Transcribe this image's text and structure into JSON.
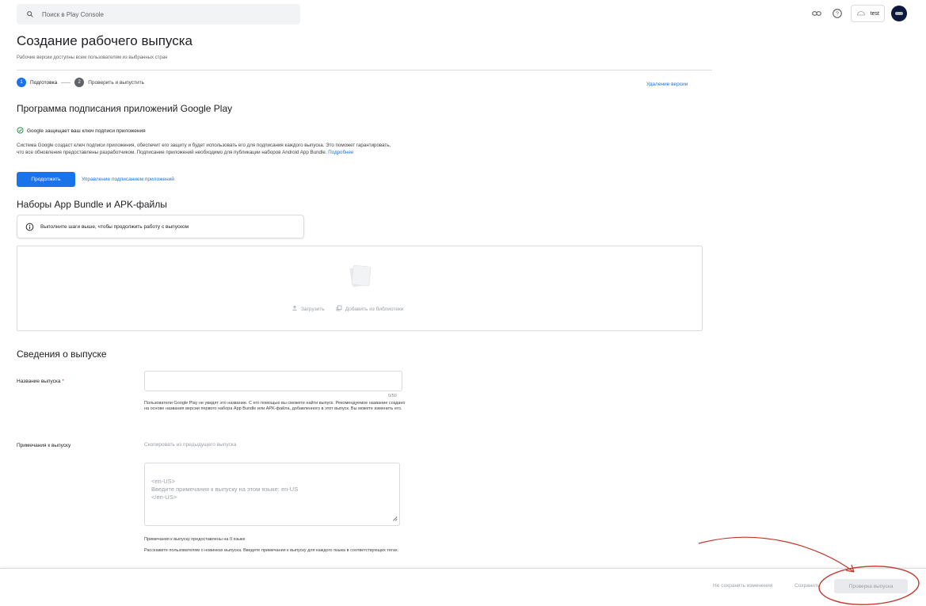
{
  "search": {
    "placeholder": "Поиск в Play Console"
  },
  "header": {
    "account_name": "test"
  },
  "page": {
    "title": "Создание рабочего выпуска",
    "subtitle": "Рабочие версии доступны всем пользователям из выбранных стран"
  },
  "stepper": {
    "steps": [
      {
        "number": "1",
        "label": "Подготовка"
      },
      {
        "number": "2",
        "label": "Проверить и выпустить"
      }
    ],
    "delete_link": "Удаление версии"
  },
  "signing": {
    "title": "Программа подписания приложений Google Play",
    "status": "Google защищает ваш ключ подписи приложения",
    "description": "Система Google создаст ключ подписи приложения, обеспечит его защиту и будет использовать его для подписания каждого выпуска. Это поможет гарантировать, что все обновления предоставлены разработчиком. Подписание приложений необходимо для публикации наборов Android App Bundle.",
    "more_link": "Подробнее",
    "continue_button": "Продолжить",
    "manage_link": "Управление подписанием приложений"
  },
  "bundles": {
    "title": "Наборы App Bundle и APK-файлы",
    "info": "Выполните шаги выше, чтобы продолжить работу с выпуском",
    "upload_label": "Загрузить",
    "library_label": "Добавить из библиотеки"
  },
  "release_info": {
    "title": "Сведения о выпуске",
    "name_label": "Название выпуска",
    "required_mark": "*",
    "name_value": "",
    "name_counter": "0/50",
    "name_helper": "Пользователи Google Play не увидят это название. С его помощью вы сможете найти выпуск. Рекомендуемое название создано на основе названия версии первого набора App Bundle или APK-файла, добавленного в этот выпуск. Вы можете изменить его.",
    "notes_label": "Примечания к выпуску",
    "copy_link": "Скопировать из предыдущего выпуска",
    "notes_placeholder": "<en-US>\nВведите примечания к выпуску на этом языке: en-US\n</en-US>",
    "notes_count": "Примечания к выпуску предоставлены на 0 языке",
    "notes_help": "Расскажите пользователям о новинках выпуска. Введите примечания к выпуску для каждого языка в соответствующих тегах."
  },
  "footer": {
    "discard": "Не сохранять изменения",
    "save": "Сохранить",
    "review": "Проверка выпуска"
  },
  "colors": {
    "accent": "#1a73e8",
    "annotation": "#c0392b"
  },
  "icons": [
    "search-icon",
    "link-icon",
    "help-icon",
    "android-icon",
    "check-circle-icon",
    "info-icon",
    "upload-icon",
    "library-icon"
  ]
}
